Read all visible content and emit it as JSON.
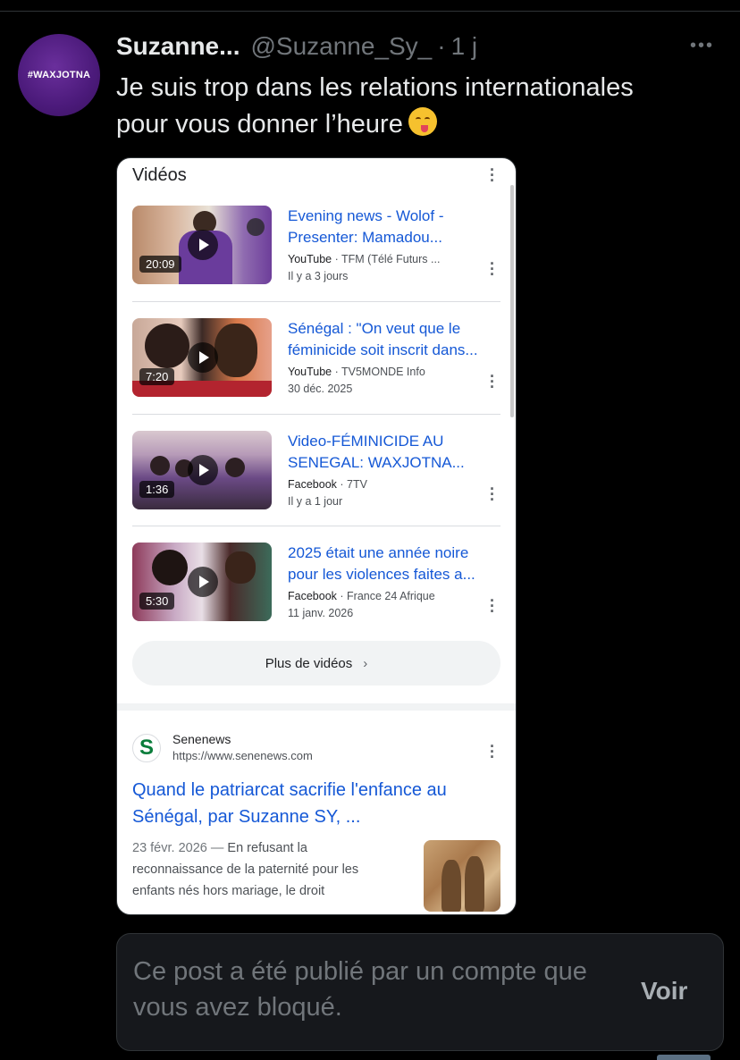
{
  "tweet": {
    "avatar_text": "#WAXJOTNA",
    "display_name": "Suzanne...",
    "handle": "@Suzanne_Sy_",
    "separator": "·",
    "time": "1 j",
    "text_line1": "Je suis trop dans les relations internationales",
    "text_line2": "pour vous donner l’heure",
    "emoji": "yum-face-emoji"
  },
  "screenshot": {
    "section_title": "Vidéos",
    "videos": [
      {
        "title_line1": "Evening news - Wolof -",
        "title_line2": "Presenter: Mamadou...",
        "source": "YouTube",
        "channel": " · TFM (Télé Futurs ...",
        "date": "Il y a 3 jours",
        "duration": "20:09"
      },
      {
        "title_line1": "Sénégal : \"On veut que le",
        "title_line2": "féminicide soit inscrit dans...",
        "source": "YouTube",
        "channel": " · TV5MONDE Info",
        "date": "30 déc. 2025",
        "duration": "7:20"
      },
      {
        "title_line1": "Video-FÉMINICIDE AU",
        "title_line2": "SENEGAL: WAXJOTNA...",
        "source": "Facebook",
        "channel": " · 7TV",
        "date": "Il y a 1 jour",
        "duration": "1:36"
      },
      {
        "title_line1": "2025 était une année noire",
        "title_line2": "pour les violences faites a...",
        "source": "Facebook",
        "channel": " · France 24 Afrique",
        "date": "11 janv. 2026",
        "duration": "5:30"
      }
    ],
    "more_videos_label": "Plus de vidéos",
    "result": {
      "site_name": "Senenews",
      "site_url": "https://www.senenews.com",
      "title_line1": "Quand le patriarcat sacrifie l'enfance au",
      "title_line2": "Sénégal, par Suzanne SY, ...",
      "date": "23 févr. 2026",
      "dash": " — ",
      "snippet_1": "En refusant la",
      "snippet_2": "reconnaissance de la paternité pour les",
      "snippet_3": "enfants nés hors mariage, le droit"
    }
  },
  "blocked_notice": {
    "text": "Ce post a été publié par un compte que vous avez bloqué.",
    "action_label": "Voir"
  }
}
